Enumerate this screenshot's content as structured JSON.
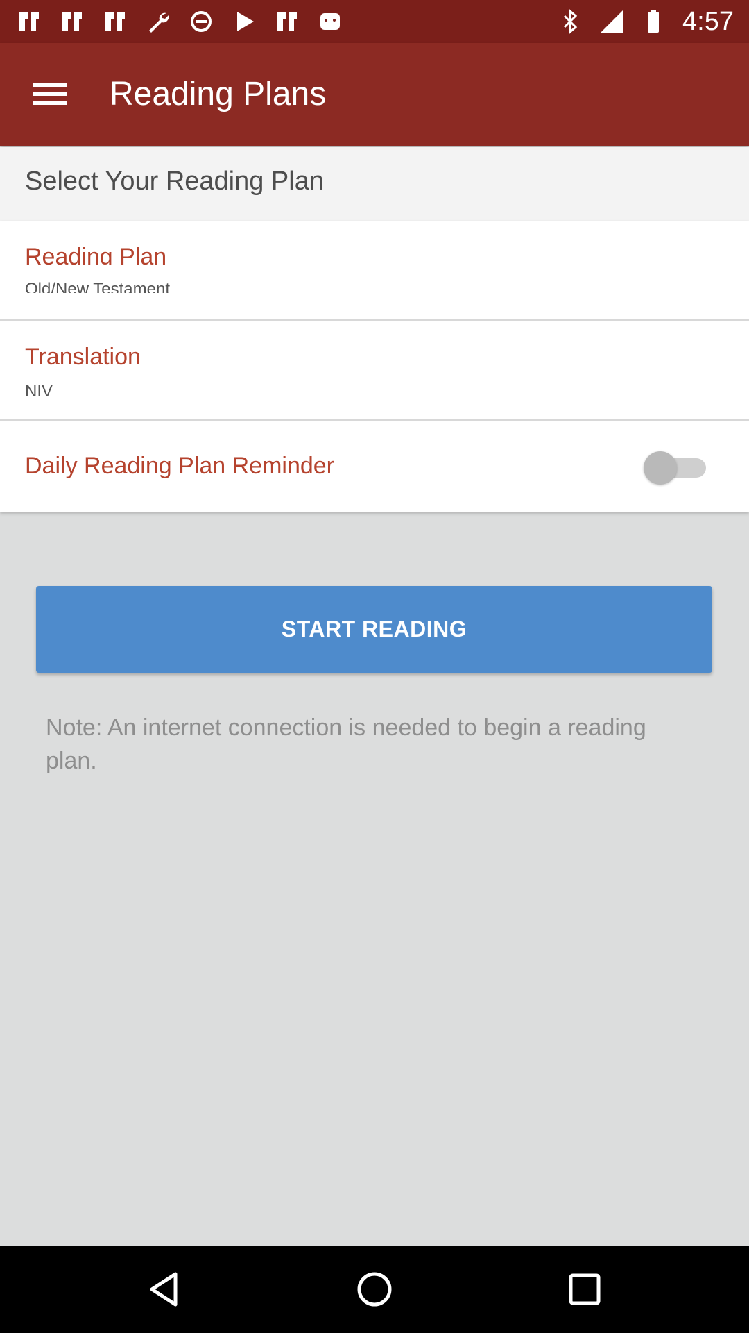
{
  "status_bar": {
    "time": "4:57",
    "icons": [
      "app-notification-icon",
      "app-notification-icon",
      "app-notification-icon",
      "wrench-icon",
      "disabled-icon",
      "play-store-icon",
      "app-notification-icon",
      "android-icon",
      "bluetooth-icon",
      "signal-icon",
      "battery-icon"
    ]
  },
  "app_bar": {
    "menu_icon": "hamburger-menu-icon",
    "title": "Reading Plans"
  },
  "section_header": {
    "title": "Select Your Reading Plan"
  },
  "settings": {
    "reading_plan": {
      "title": "Reading Plan",
      "value": "Old/New Testament"
    },
    "translation": {
      "title": "Translation",
      "value": "NIV"
    },
    "reminder": {
      "title": "Daily Reading Plan Reminder",
      "enabled": false
    }
  },
  "start_button": {
    "label": "START READING"
  },
  "note": "Note: An internet connection is needed to begin a reading plan.",
  "nav_bar": {
    "back_icon": "back-triangle-icon",
    "home_icon": "home-circle-icon",
    "recents_icon": "recents-square-icon"
  },
  "colors": {
    "status_bar": "#7b1f1a",
    "app_bar": "#8c2a23",
    "accent_text": "#b5432e",
    "button": "#4e8bcc",
    "background": "#dcdddd"
  }
}
